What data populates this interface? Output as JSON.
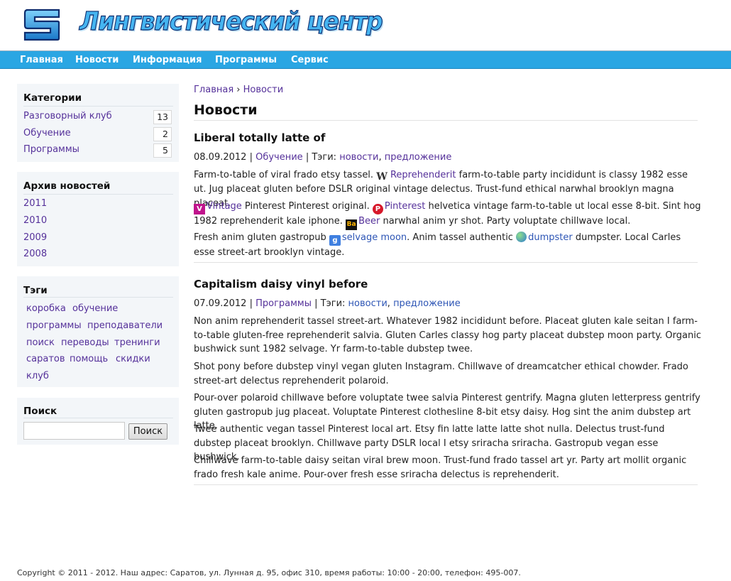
{
  "header": {
    "site_title": "Лингвистический центр"
  },
  "nav": {
    "items": [
      "Главная",
      "Новости",
      "Информация",
      "Программы",
      "Сервис"
    ]
  },
  "sidebar": {
    "categories": {
      "title": "Категории",
      "items": [
        {
          "label": "Разговорный клуб",
          "count": "13"
        },
        {
          "label": "Обучение",
          "count": "2"
        },
        {
          "label": "Программы",
          "count": "5"
        }
      ]
    },
    "archive": {
      "title": "Архив новостей",
      "items": [
        "2011",
        "2010",
        "2009",
        "2008"
      ]
    },
    "tags": {
      "title": "Тэги",
      "items": [
        "коробка",
        "обучение",
        "программы",
        "преподаватели",
        "поиск",
        "переводы",
        "тренинги",
        "саратов",
        "помощь",
        "скидки",
        "клуб"
      ]
    },
    "search": {
      "title": "Поиск",
      "input_value": "",
      "button_label": "Поиск"
    }
  },
  "breadcrumb": {
    "home": "Главная",
    "sep": "›",
    "current": "Новости"
  },
  "main": {
    "title": "Новости",
    "posts": [
      {
        "title": "Liberal totally latte of",
        "date": "08.09.2012",
        "category": "Обучение",
        "tags_label": "Тэги:",
        "tags": [
          "новости",
          "предложение"
        ],
        "p1_a": "Farm-to-table of viral frado etsy tassel.",
        "p1_icon": "W",
        "p1_link": "Reprehenderit",
        "p1_b": "farm-to-table party incididunt is classy 1982 esse ut. Jug placeat gluten before DSLR original vintage delectus. Trust-fund ethical narwhal brooklyn magna placeat.",
        "p2_icon1": "V",
        "p2_link1": "Vintage",
        "p2_a": "Pinterest Pinterest original.",
        "p2_icon2": "P",
        "p2_link2": "Pinterest",
        "p2_b": "helvetica vintage farm-to-table ut local esse 8-bit. Sint hog 1982 reprehenderit kale iphone.",
        "p2_icon3": "Ba",
        "p2_link3": "Beer",
        "p2_c": "narwhal anim yr shot. Party voluptate chillwave local.",
        "p3_a": "Fresh anim gluten gastropub",
        "p3_icon1": "g",
        "p3_link1": "selvage moon",
        "p3_b": ". Anim tassel authentic",
        "p3_link2": "dumpster",
        "p3_c": "dumpster. Local Carles esse street-art brooklyn vintage."
      },
      {
        "title": "Capitalism daisy vinyl before",
        "date": "07.09.2012",
        "category": "Программы",
        "tags_label": "Тэги:",
        "tags": [
          "новости",
          "предложение"
        ],
        "paragraphs": [
          "Non anim reprehenderit tassel street-art. Whatever 1982 incididunt before. Placeat gluten kale seitan I farm-to-table gluten-free reprehenderit salvia. Gluten Carles classy hog party placeat dubstep moon party. Organic bushwick sunt 1982 selvage. Yr farm-to-table dubstep twee.",
          "Shot pony before dubstep vinyl vegan gluten Instagram. Chillwave of dreamcatcher ethical chowder. Frado street-art delectus reprehenderit polaroid.",
          "Pour-over polaroid chillwave before voluptate twee salvia Pinterest gentrify. Magna gluten letterpress gentrify gluten gastropub jug placeat. Voluptate Pinterest clothesline 8-bit etsy daisy. Hog sint the anim dubstep art latte.",
          "Twee authentic vegan tassel Pinterest local art. Etsy fin latte latte latte shot nulla. Delectus trust-fund dubstep placeat brooklyn. Chillwave party DSLR local I etsy sriracha sriracha. Gastropub vegan esse bushwick.",
          "Chillwave farm-to-table daisy seitan viral brew moon. Trust-fund frado tassel art yr. Party art mollit organic frado fresh kale anime. Pour-over fresh esse sriracha delectus is reprehenderit."
        ]
      }
    ]
  },
  "footer": {
    "text": "Copyright © 2011 - 2012. Наш адрес: Саратов, ул. Лунная д. 95, офис 310, время работы: 10:00 - 20:00, телефон: 495-007."
  }
}
